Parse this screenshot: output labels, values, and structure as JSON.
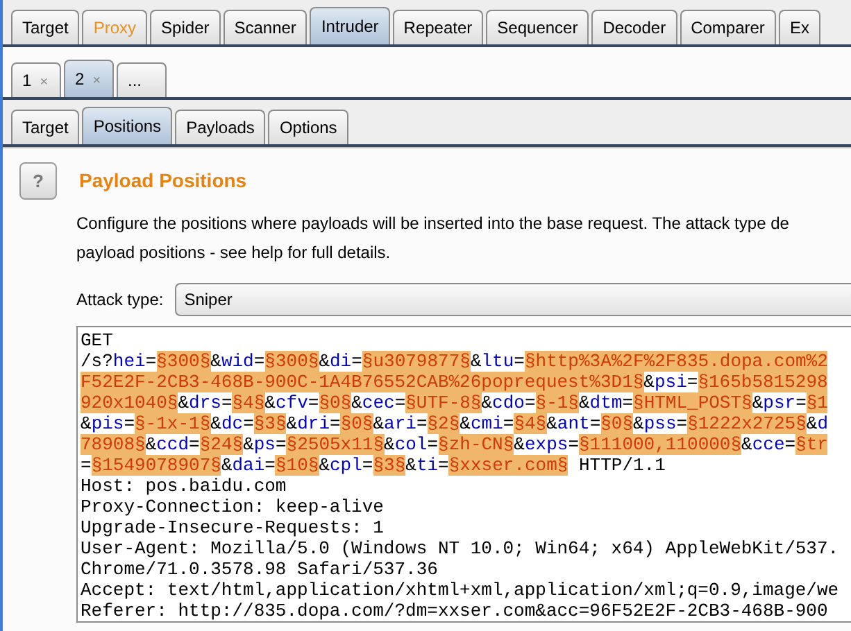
{
  "main_tabs": [
    {
      "label": "Target",
      "selected": false,
      "highlighted": false
    },
    {
      "label": "Proxy",
      "selected": false,
      "highlighted": true
    },
    {
      "label": "Spider",
      "selected": false,
      "highlighted": false
    },
    {
      "label": "Scanner",
      "selected": false,
      "highlighted": false
    },
    {
      "label": "Intruder",
      "selected": true,
      "highlighted": false
    },
    {
      "label": "Repeater",
      "selected": false,
      "highlighted": false
    },
    {
      "label": "Sequencer",
      "selected": false,
      "highlighted": false
    },
    {
      "label": "Decoder",
      "selected": false,
      "highlighted": false
    },
    {
      "label": "Comparer",
      "selected": false,
      "highlighted": false
    },
    {
      "label": "Ex",
      "selected": false,
      "highlighted": false
    }
  ],
  "attack_tabs": [
    {
      "label": "1",
      "close": "×",
      "selected": false
    },
    {
      "label": "2",
      "close": "×",
      "selected": true
    },
    {
      "label": "...",
      "selected": false
    }
  ],
  "sub_tabs": [
    {
      "label": "Target",
      "selected": false
    },
    {
      "label": "Positions",
      "selected": true
    },
    {
      "label": "Payloads",
      "selected": false
    },
    {
      "label": "Options",
      "selected": false
    }
  ],
  "section": {
    "help": "?",
    "title": "Payload Positions",
    "description": [
      "Configure the positions where payloads will be inserted into the base request. The attack type de",
      "payload positions - see help for full details."
    ],
    "attack_type_label": "Attack type:",
    "attack_type": "Sniper"
  },
  "request_lines": [
    [
      {
        "kind": "plain",
        "text": "GET"
      }
    ],
    [
      {
        "kind": "plain",
        "text": "/s?"
      },
      {
        "kind": "param",
        "text": "hei"
      },
      {
        "kind": "plain",
        "text": "="
      },
      {
        "kind": "payload",
        "text": "§300§"
      },
      {
        "kind": "plain",
        "text": "&"
      },
      {
        "kind": "param",
        "text": "wid"
      },
      {
        "kind": "plain",
        "text": "="
      },
      {
        "kind": "payload",
        "text": "§300§"
      },
      {
        "kind": "plain",
        "text": "&"
      },
      {
        "kind": "param",
        "text": "di"
      },
      {
        "kind": "plain",
        "text": "="
      },
      {
        "kind": "payload",
        "text": "§u3079877§"
      },
      {
        "kind": "plain",
        "text": "&"
      },
      {
        "kind": "param",
        "text": "ltu"
      },
      {
        "kind": "plain",
        "text": "="
      },
      {
        "kind": "payload",
        "text": "§http%3A%2F%2F835.dopa.com%2"
      }
    ],
    [
      {
        "kind": "payload",
        "text": "F52E2F-2CB3-468B-900C-1A4B76552CAB%26poprequest%3D1§"
      },
      {
        "kind": "plain",
        "text": "&"
      },
      {
        "kind": "param",
        "text": "psi"
      },
      {
        "kind": "plain",
        "text": "="
      },
      {
        "kind": "payload",
        "text": "§165b5815298"
      }
    ],
    [
      {
        "kind": "payload",
        "text": "920x1040§"
      },
      {
        "kind": "plain",
        "text": "&"
      },
      {
        "kind": "param",
        "text": "drs"
      },
      {
        "kind": "plain",
        "text": "="
      },
      {
        "kind": "payload",
        "text": "§4§"
      },
      {
        "kind": "plain",
        "text": "&"
      },
      {
        "kind": "param",
        "text": "cfv"
      },
      {
        "kind": "plain",
        "text": "="
      },
      {
        "kind": "payload",
        "text": "§0§"
      },
      {
        "kind": "plain",
        "text": "&"
      },
      {
        "kind": "param",
        "text": "cec"
      },
      {
        "kind": "plain",
        "text": "="
      },
      {
        "kind": "payload",
        "text": "§UTF-8§"
      },
      {
        "kind": "plain",
        "text": "&"
      },
      {
        "kind": "param",
        "text": "cdo"
      },
      {
        "kind": "plain",
        "text": "="
      },
      {
        "kind": "payload",
        "text": "§-1§"
      },
      {
        "kind": "plain",
        "text": "&"
      },
      {
        "kind": "param",
        "text": "dtm"
      },
      {
        "kind": "plain",
        "text": "="
      },
      {
        "kind": "payload",
        "text": "§HTML_POST§"
      },
      {
        "kind": "plain",
        "text": "&"
      },
      {
        "kind": "param",
        "text": "psr"
      },
      {
        "kind": "plain",
        "text": "="
      },
      {
        "kind": "payload",
        "text": "§1"
      }
    ],
    [
      {
        "kind": "plain",
        "text": "&"
      },
      {
        "kind": "param",
        "text": "pis"
      },
      {
        "kind": "plain",
        "text": "="
      },
      {
        "kind": "payload",
        "text": "§-1x-1§"
      },
      {
        "kind": "plain",
        "text": "&"
      },
      {
        "kind": "param",
        "text": "dc"
      },
      {
        "kind": "plain",
        "text": "="
      },
      {
        "kind": "payload",
        "text": "§3§"
      },
      {
        "kind": "plain",
        "text": "&"
      },
      {
        "kind": "param",
        "text": "dri"
      },
      {
        "kind": "plain",
        "text": "="
      },
      {
        "kind": "payload",
        "text": "§0§"
      },
      {
        "kind": "plain",
        "text": "&"
      },
      {
        "kind": "param",
        "text": "ari"
      },
      {
        "kind": "plain",
        "text": "="
      },
      {
        "kind": "payload",
        "text": "§2§"
      },
      {
        "kind": "plain",
        "text": "&"
      },
      {
        "kind": "param",
        "text": "cmi"
      },
      {
        "kind": "plain",
        "text": "="
      },
      {
        "kind": "payload",
        "text": "§4§"
      },
      {
        "kind": "plain",
        "text": "&"
      },
      {
        "kind": "param",
        "text": "ant"
      },
      {
        "kind": "plain",
        "text": "="
      },
      {
        "kind": "payload",
        "text": "§0§"
      },
      {
        "kind": "plain",
        "text": "&"
      },
      {
        "kind": "param",
        "text": "pss"
      },
      {
        "kind": "plain",
        "text": "="
      },
      {
        "kind": "payload",
        "text": "§1222x2725§"
      },
      {
        "kind": "plain",
        "text": "&"
      },
      {
        "kind": "param",
        "text": "d"
      }
    ],
    [
      {
        "kind": "payload",
        "text": "78908§"
      },
      {
        "kind": "plain",
        "text": "&"
      },
      {
        "kind": "param",
        "text": "ccd"
      },
      {
        "kind": "plain",
        "text": "="
      },
      {
        "kind": "payload",
        "text": "§24§"
      },
      {
        "kind": "plain",
        "text": "&"
      },
      {
        "kind": "param",
        "text": "ps"
      },
      {
        "kind": "plain",
        "text": "="
      },
      {
        "kind": "payload",
        "text": "§2505x11§"
      },
      {
        "kind": "plain",
        "text": "&"
      },
      {
        "kind": "param",
        "text": "col"
      },
      {
        "kind": "plain",
        "text": "="
      },
      {
        "kind": "payload",
        "text": "§zh-CN§"
      },
      {
        "kind": "plain",
        "text": "&"
      },
      {
        "kind": "param",
        "text": "exps"
      },
      {
        "kind": "plain",
        "text": "="
      },
      {
        "kind": "payload",
        "text": "§111000,110000§"
      },
      {
        "kind": "plain",
        "text": "&"
      },
      {
        "kind": "param",
        "text": "cce"
      },
      {
        "kind": "plain",
        "text": "="
      },
      {
        "kind": "payload",
        "text": "§tr"
      }
    ],
    [
      {
        "kind": "plain",
        "text": "="
      },
      {
        "kind": "payload",
        "text": "§1549078907§"
      },
      {
        "kind": "plain",
        "text": "&"
      },
      {
        "kind": "param",
        "text": "dai"
      },
      {
        "kind": "plain",
        "text": "="
      },
      {
        "kind": "payload",
        "text": "§10§"
      },
      {
        "kind": "plain",
        "text": "&"
      },
      {
        "kind": "param",
        "text": "cpl"
      },
      {
        "kind": "plain",
        "text": "="
      },
      {
        "kind": "payload",
        "text": "§3§"
      },
      {
        "kind": "plain",
        "text": "&"
      },
      {
        "kind": "param",
        "text": "ti"
      },
      {
        "kind": "plain",
        "text": "="
      },
      {
        "kind": "payload",
        "text": "§xxser.com§"
      },
      {
        "kind": "plain",
        "text": " HTTP/1.1"
      }
    ],
    [
      {
        "kind": "plain",
        "text": "Host: pos.baidu.com"
      }
    ],
    [
      {
        "kind": "plain",
        "text": "Proxy-Connection: keep-alive"
      }
    ],
    [
      {
        "kind": "plain",
        "text": "Upgrade-Insecure-Requests: 1"
      }
    ],
    [
      {
        "kind": "plain",
        "text": "User-Agent: Mozilla/5.0 (Windows NT 10.0; Win64; x64) AppleWebKit/537."
      }
    ],
    [
      {
        "kind": "plain",
        "text": "Chrome/71.0.3578.98 Safari/537.36"
      }
    ],
    [
      {
        "kind": "plain",
        "text": "Accept: text/html,application/xhtml+xml,application/xml;q=0.9,image/we"
      }
    ],
    [
      {
        "kind": "plain",
        "text": "Referer: http://835.dopa.com/?dm=xxser.com&acc=96F52E2F-2CB3-468B-900"
      }
    ]
  ]
}
